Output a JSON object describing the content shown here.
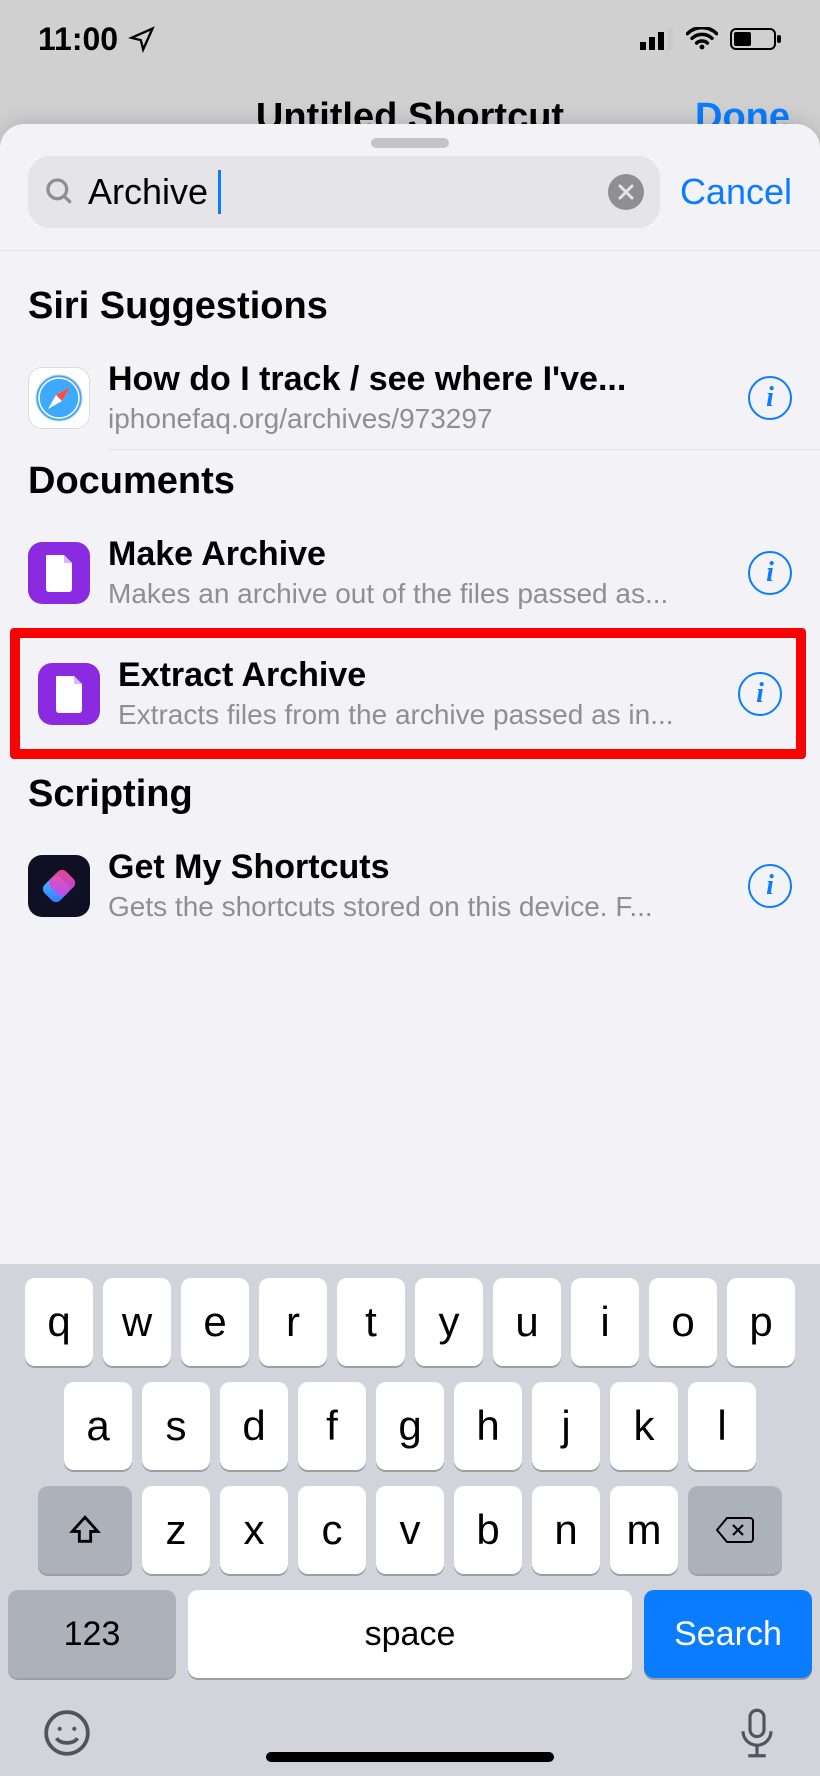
{
  "status_bar": {
    "time": "11:00"
  },
  "background": {
    "title": "Untitled Shortcut",
    "done_button": "Done"
  },
  "search": {
    "value": "Archive",
    "cancel_label": "Cancel"
  },
  "sections": {
    "siri": {
      "header": "Siri Suggestions",
      "items": [
        {
          "icon": "safari-icon",
          "title": "How do I track / see where I've...",
          "subtitle": "iphonefaq.org/archives/973297"
        }
      ]
    },
    "documents": {
      "header": "Documents",
      "items": [
        {
          "icon": "document-icon",
          "title": "Make Archive",
          "subtitle": "Makes an archive out of the files passed as..."
        },
        {
          "icon": "document-icon",
          "title": "Extract Archive",
          "subtitle": "Extracts files from the archive passed as in..."
        }
      ]
    },
    "scripting": {
      "header": "Scripting",
      "items": [
        {
          "icon": "shortcuts-icon",
          "title": "Get My Shortcuts",
          "subtitle": "Gets the shortcuts stored on this device. F..."
        }
      ]
    }
  },
  "keyboard": {
    "rows": [
      [
        "q",
        "w",
        "e",
        "r",
        "t",
        "y",
        "u",
        "i",
        "o",
        "p"
      ],
      [
        "a",
        "s",
        "d",
        "f",
        "g",
        "h",
        "j",
        "k",
        "l"
      ],
      [
        "z",
        "x",
        "c",
        "v",
        "b",
        "n",
        "m"
      ]
    ],
    "key_123": "123",
    "space_label": "space",
    "search_label": "Search"
  },
  "colors": {
    "accent": "#0a7cff",
    "doc_purple": "#8a2be2",
    "highlight": "#ff0000"
  }
}
